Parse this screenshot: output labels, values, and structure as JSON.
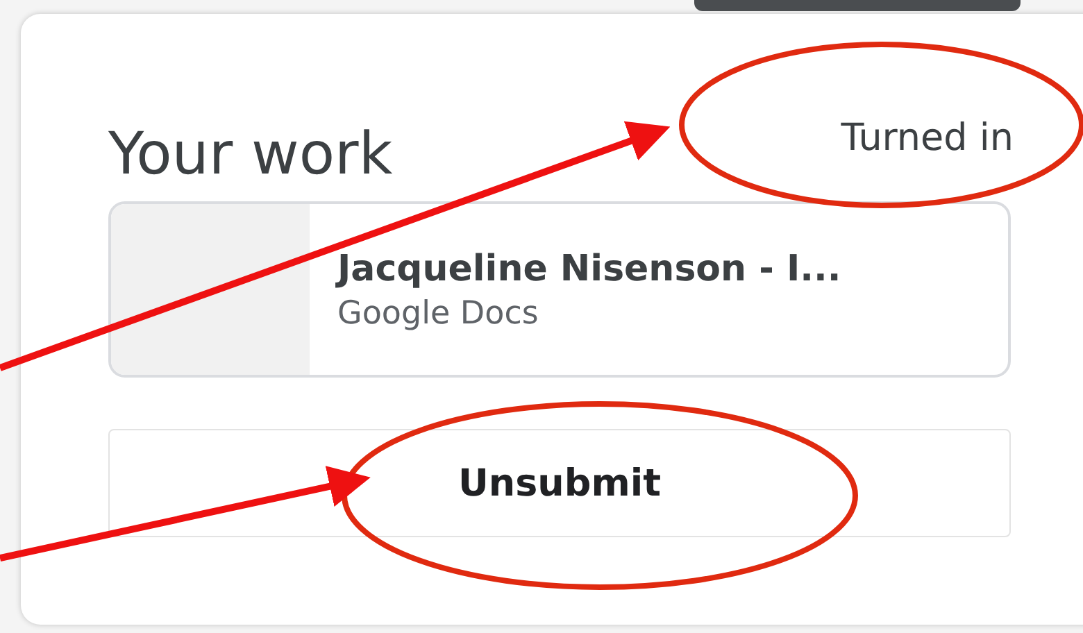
{
  "card": {
    "title": "Your work",
    "status": "Turned in"
  },
  "attachment": {
    "name": "Jacqueline Nisenson - I...",
    "type": "Google Docs"
  },
  "button": {
    "label": "Unsubmit"
  }
}
